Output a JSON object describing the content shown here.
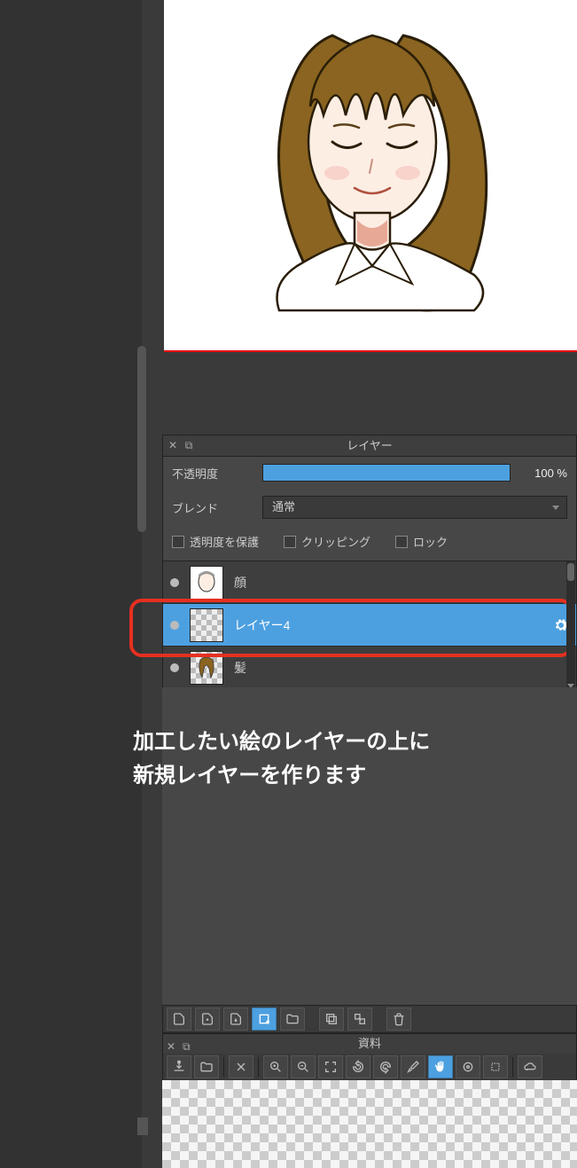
{
  "layer_panel": {
    "title": "レイヤー",
    "opacity_label": "不透明度",
    "opacity_value": "100 %",
    "blend_label": "ブレンド",
    "blend_value": "通常",
    "preserve_alpha": "透明度を保護",
    "clipping": "クリッピング",
    "lock": "ロック",
    "layers": [
      {
        "name": "顔",
        "selected": false,
        "thumb": "face"
      },
      {
        "name": "レイヤー4",
        "selected": true,
        "thumb": "blank"
      },
      {
        "name": "髪",
        "selected": false,
        "thumb": "hair"
      }
    ]
  },
  "instruction_text": "加工したい絵のレイヤーの上に\n新規レイヤーを作ります",
  "resource_panel": {
    "title": "資料"
  },
  "icons": {
    "close": "✕",
    "popout": "⧉"
  }
}
